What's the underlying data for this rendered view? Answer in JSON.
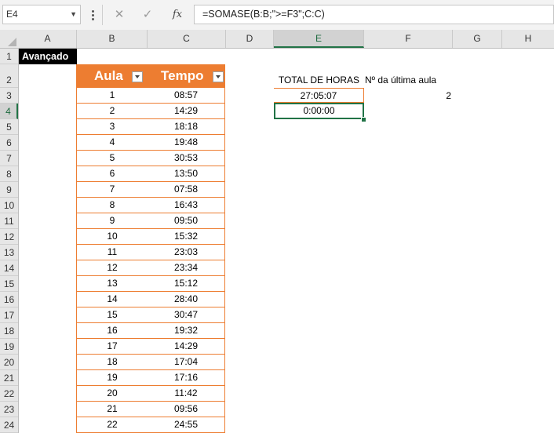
{
  "formula_bar": {
    "name_box": "E4",
    "formula": "=SOMASE(B:B;\">=F3\";C:C)",
    "fx_label": "fx",
    "cancel_icon": "cancel-icon",
    "enter_icon": "enter-check-icon"
  },
  "columns": [
    "A",
    "B",
    "C",
    "D",
    "E",
    "F",
    "G",
    "H"
  ],
  "selected_column": "E",
  "rows": [
    "1",
    "2",
    "3",
    "4",
    "5",
    "6",
    "7",
    "8",
    "9",
    "10",
    "11",
    "12",
    "13",
    "14",
    "15",
    "16",
    "17",
    "18",
    "19",
    "20",
    "21",
    "22",
    "23",
    "24"
  ],
  "selected_row": "4",
  "cells": {
    "A1": "Avançado",
    "E2": "TOTAL DE HORAS",
    "F2": "Nº da última aula",
    "E3": "27:05:07",
    "F3": "2",
    "E4": "0:00:00"
  },
  "table": {
    "headers": [
      "Aula",
      "Tempo"
    ],
    "rows": [
      [
        "1",
        "08:57"
      ],
      [
        "2",
        "14:29"
      ],
      [
        "3",
        "18:18"
      ],
      [
        "4",
        "19:48"
      ],
      [
        "5",
        "30:53"
      ],
      [
        "6",
        "13:50"
      ],
      [
        "7",
        "07:58"
      ],
      [
        "8",
        "16:43"
      ],
      [
        "9",
        "09:50"
      ],
      [
        "10",
        "15:32"
      ],
      [
        "11",
        "23:03"
      ],
      [
        "12",
        "23:34"
      ],
      [
        "13",
        "15:12"
      ],
      [
        "14",
        "28:40"
      ],
      [
        "15",
        "30:47"
      ],
      [
        "16",
        "19:32"
      ],
      [
        "17",
        "14:29"
      ],
      [
        "18",
        "17:04"
      ],
      [
        "19",
        "17:16"
      ],
      [
        "20",
        "11:42"
      ],
      [
        "21",
        "09:56"
      ],
      [
        "22",
        "24:55"
      ]
    ]
  },
  "colors": {
    "table_header": "#ed7d31",
    "table_border": "#ed7d31",
    "selection": "#217346"
  }
}
